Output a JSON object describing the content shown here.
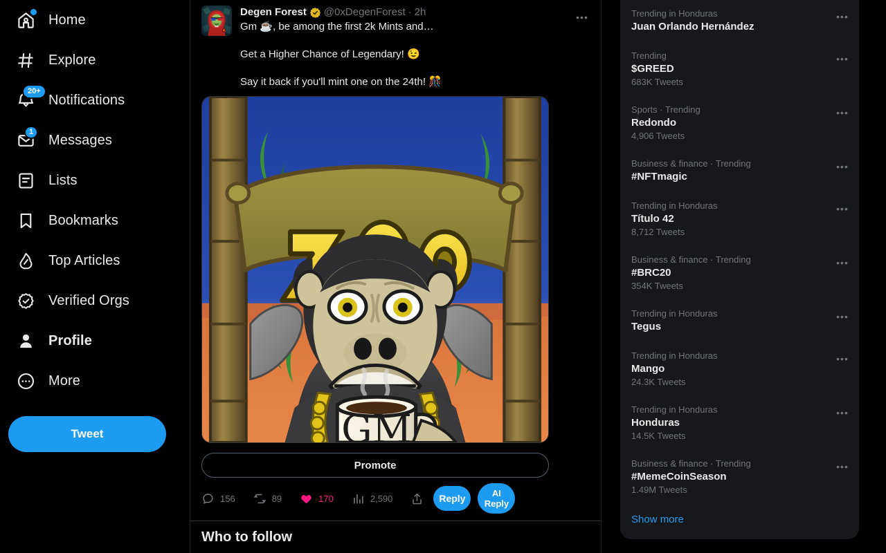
{
  "sidebar": {
    "items": [
      {
        "label": "Home",
        "icon": "home-icon",
        "badge": "",
        "badge_type": "dot",
        "active": false
      },
      {
        "label": "Explore",
        "icon": "hashtag-icon",
        "badge": "",
        "badge_type": "none",
        "active": false
      },
      {
        "label": "Notifications",
        "icon": "bell-icon",
        "badge": "20+",
        "badge_type": "count",
        "active": false
      },
      {
        "label": "Messages",
        "icon": "envelope-icon",
        "badge": "1",
        "badge_type": "count",
        "active": false
      },
      {
        "label": "Lists",
        "icon": "list-icon",
        "badge": "",
        "badge_type": "none",
        "active": false
      },
      {
        "label": "Bookmarks",
        "icon": "bookmark-icon",
        "badge": "",
        "badge_type": "none",
        "active": false
      },
      {
        "label": "Top Articles",
        "icon": "flame-icon",
        "badge": "",
        "badge_type": "none",
        "active": false
      },
      {
        "label": "Verified Orgs",
        "icon": "verified-badge-icon",
        "badge": "",
        "badge_type": "none",
        "active": false
      },
      {
        "label": "Profile",
        "icon": "person-icon",
        "badge": "",
        "badge_type": "none",
        "active": true
      },
      {
        "label": "More",
        "icon": "more-circle-icon",
        "badge": "",
        "badge_type": "none",
        "active": false
      }
    ],
    "tweet_button_label": "Tweet"
  },
  "tweet": {
    "display_name": "Degen Forest",
    "verified": true,
    "verified_color": "#e2b719",
    "handle": "@0xDegenForest",
    "separator": "·",
    "timestamp": "2h",
    "text_lines": [
      "Gm ☕,  be among the first 2k Mints and…",
      "Get a Higher Chance of Legendary! 😉",
      "Say it back if you'll mint one on the 24th! 🎊"
    ],
    "media_alt": "ZOO ape holding GM mug NFT artwork",
    "promote_label": "Promote",
    "actions": {
      "reply_count": "156",
      "retweet_count": "89",
      "like_count": "170",
      "views_count": "2,590",
      "liked": true,
      "like_color": "#f91880",
      "reply_button_label": "Reply",
      "ai_reply_button_line1": "AI",
      "ai_reply_button_line2": "Reply"
    },
    "more_menu_label": "More"
  },
  "feed": {
    "who_to_follow_title": "Who to follow"
  },
  "trending": {
    "items": [
      {
        "category": "Trending in Honduras",
        "name": "Juan Orlando Hernández",
        "count": ""
      },
      {
        "category": "Trending",
        "name": "$GREED",
        "count": "683K Tweets"
      },
      {
        "category": "Sports · Trending",
        "name": "Redondo",
        "count": "4,906 Tweets"
      },
      {
        "category": "Business & finance · Trending",
        "name": "#NFTmagic",
        "count": ""
      },
      {
        "category": "Trending in Honduras",
        "name": "Título 42",
        "count": "8,712 Tweets"
      },
      {
        "category": "Business & finance · Trending",
        "name": "#BRC20",
        "count": "354K Tweets"
      },
      {
        "category": "Trending in Honduras",
        "name": "Tegus",
        "count": ""
      },
      {
        "category": "Trending in Honduras",
        "name": "Mango",
        "count": "24.3K Tweets"
      },
      {
        "category": "Trending in Honduras",
        "name": "Honduras",
        "count": "14.5K Tweets"
      },
      {
        "category": "Business & finance · Trending",
        "name": "#MemeCoinSeason",
        "count": "1.49M Tweets"
      }
    ],
    "show_more_label": "Show more"
  },
  "colors": {
    "accent": "#1d9bf0",
    "background": "#000000",
    "panel": "#16181c",
    "muted_text": "#71767b",
    "primary_text": "#e7e9ea",
    "like": "#f91880",
    "verified_gold": "#e2b719"
  }
}
